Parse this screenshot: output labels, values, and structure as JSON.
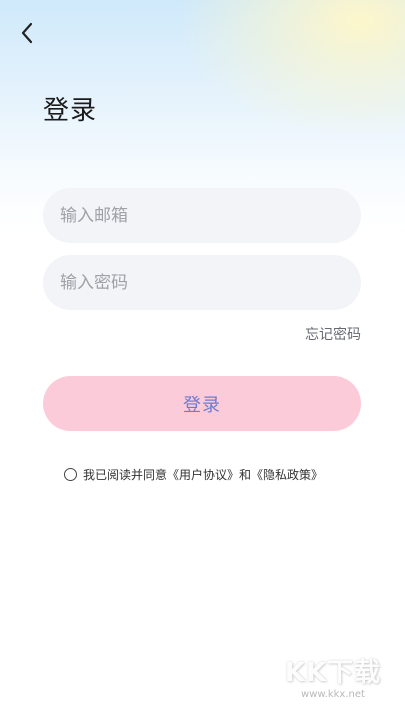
{
  "page": {
    "title": "登录"
  },
  "form": {
    "email_placeholder": "输入邮箱",
    "password_placeholder": "输入密码",
    "forgot_label": "忘记密码",
    "login_label": "登录"
  },
  "agreement": {
    "prefix": "我已阅读并同意",
    "user_agreement": "《用户协议》",
    "and": "和",
    "privacy_policy": "《隐私政策》"
  },
  "watermark": {
    "logo_text": "KK下载",
    "url": "www.kkx.net"
  },
  "colors": {
    "login_button_bg": "#fccbd9",
    "login_button_text": "#6f7bcc",
    "input_bg": "#f3f4f8",
    "header_gradient_blue": "#cfe9fb",
    "header_gradient_yellow": "#fff7c8"
  },
  "icons": {
    "back": "chevron-left-icon",
    "agreement_checkbox": "radio-unchecked-icon"
  }
}
